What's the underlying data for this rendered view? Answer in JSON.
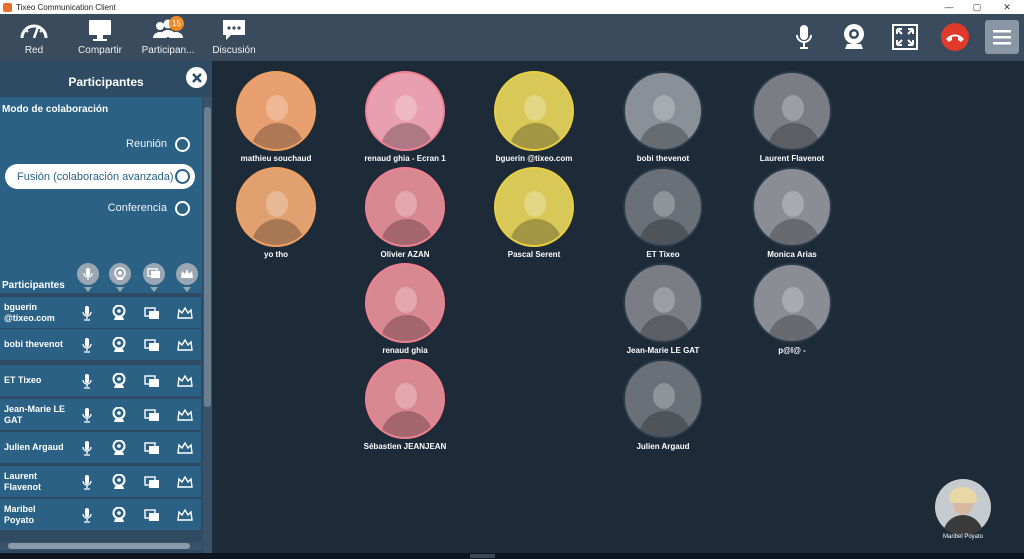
{
  "window": {
    "title": "Tixeo Communication Client"
  },
  "toolbar": {
    "items": [
      {
        "label": "Red",
        "icon": "network-gauge-icon"
      },
      {
        "label": "Compartir",
        "icon": "monitor-share-icon"
      },
      {
        "label": "Participan...",
        "icon": "participants-icon",
        "badge": "15"
      },
      {
        "label": "Discusión",
        "icon": "chat-icon"
      }
    ],
    "right_icons": [
      "microphone-icon",
      "webcam-icon",
      "fullscreen-icon",
      "hangup-icon",
      "menu-icon"
    ]
  },
  "sidebar": {
    "title": "Participantes",
    "collab_title": "Modo de colaboración",
    "modes": [
      {
        "label": "Reunión",
        "selected": false
      },
      {
        "label": "Fusión (colaboración avanzada)",
        "selected": true
      },
      {
        "label": "Conferencia",
        "selected": false
      }
    ],
    "participants_label": "Participantes",
    "participants": [
      {
        "name": "bguerin @tixeo.com"
      },
      {
        "name": "bobi thevenot"
      },
      {
        "name": "ET Tixeo"
      },
      {
        "name": "Jean-Marie LE GAT"
      },
      {
        "name": "Julien Argaud"
      },
      {
        "name": "Laurent Flavenot"
      },
      {
        "name": "Maribel Poyato"
      }
    ]
  },
  "stage": {
    "tiles": [
      {
        "name": "mathieu souchaud",
        "ring": "#f0a060",
        "tint": "#e8a070"
      },
      {
        "name": "renaud ghia - Ecran 1",
        "ring": "#f08090",
        "tint": "#e8a0b0"
      },
      {
        "name": "bguerin @tixeo.com",
        "ring": "#e8d040",
        "tint": "#d8c858"
      },
      {
        "name": "bobi thevenot",
        "ring": "#2a3a4a",
        "tint": "#8a9098"
      },
      {
        "name": "Laurent Flavenot",
        "ring": "#2a3a4a",
        "tint": "#7a7e84"
      },
      {
        "name": "yo tho",
        "ring": "#f0a060",
        "tint": "#e0a070"
      },
      {
        "name": "Olivier AZAN",
        "ring": "#f08090",
        "tint": "#d88890"
      },
      {
        "name": "Pascal Serent",
        "ring": "#e8d040",
        "tint": "#d8c858"
      },
      {
        "name": "ET Tixeo",
        "ring": "#2a3a4a",
        "tint": "#6a7078"
      },
      {
        "name": "Monica Arias",
        "ring": "#2a3a4a",
        "tint": "#8a8e94"
      },
      {
        "name": "renaud ghia",
        "ring": "#f08090",
        "tint": "#d88890"
      },
      {
        "name": "Jean-Marie LE GAT",
        "ring": "#2a3a4a",
        "tint": "#7a7e84"
      },
      {
        "name": "p@l@ -",
        "ring": "#2a3a4a",
        "tint": "#8a8e94"
      },
      {
        "name": "Sébastien JEANJEAN",
        "ring": "#f08090",
        "tint": "#d88890"
      },
      {
        "name": "Julien Argaud",
        "ring": "#2a3a4a",
        "tint": "#6a7078"
      }
    ],
    "self_name": "Maribel Poyato"
  }
}
